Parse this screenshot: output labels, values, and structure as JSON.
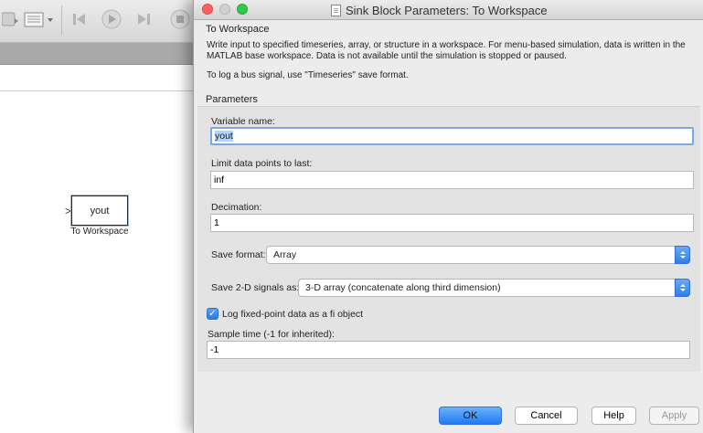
{
  "background_window": {
    "block_label": "yout",
    "block_caption": "To Workspace",
    "port_marker": ">"
  },
  "dialog": {
    "title": "Sink Block Parameters: To Workspace",
    "block_type": "To Workspace",
    "description_1": "Write input to specified timeseries, array, or structure in a workspace. For menu-based simulation, data is written in the MATLAB base workspace. Data is not available until the simulation is stopped or paused.",
    "description_2": "To log a bus signal, use \"Timeseries\" save format.",
    "parameters_label": "Parameters",
    "variable_name": {
      "label": "Variable name:",
      "value": "yout"
    },
    "limit_points": {
      "label": "Limit data points to last:",
      "value": "inf"
    },
    "decimation": {
      "label": "Decimation:",
      "value": "1"
    },
    "save_format": {
      "label": "Save format:",
      "selected": "Array"
    },
    "save_2d": {
      "label": "Save 2-D signals as:",
      "selected": "3-D array (concatenate along third dimension)"
    },
    "log_fixed_point": {
      "label": "Log fixed-point data as a fi object",
      "checked": true,
      "mark": "✓"
    },
    "sample_time": {
      "label": "Sample time (-1 for inherited):",
      "value": "-1"
    },
    "buttons": {
      "ok": "OK",
      "cancel": "Cancel",
      "help": "Help",
      "apply": "Apply"
    }
  },
  "colors": {
    "accent": "#2f7fe8",
    "close_light": "#fc605c",
    "minimize_light": "#d0d0d0",
    "zoom_light": "#34c84a"
  }
}
